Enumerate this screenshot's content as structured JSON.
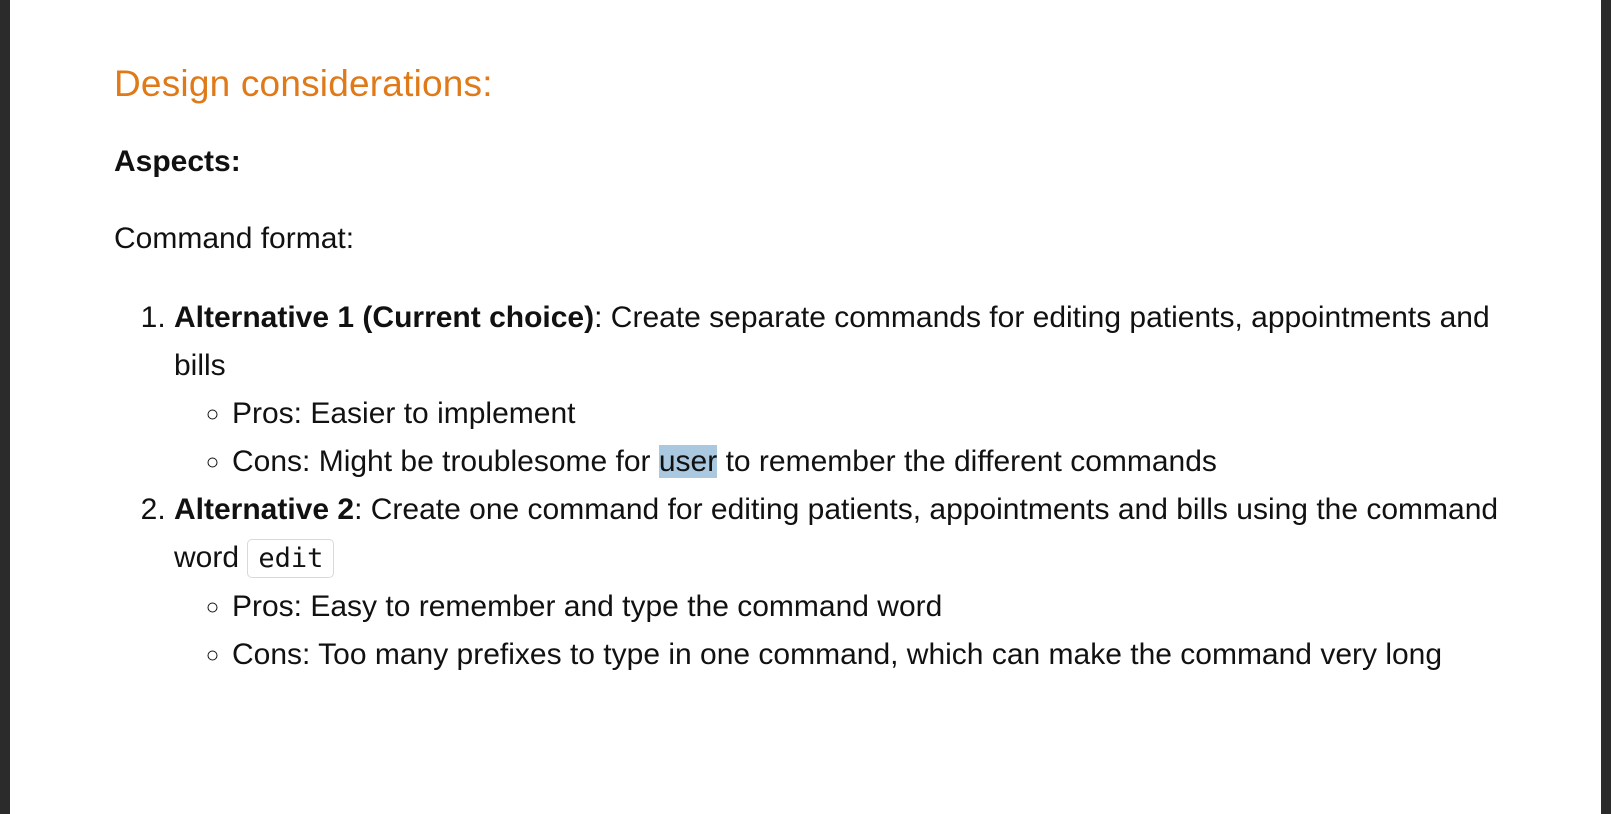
{
  "colors": {
    "heading": "#e07a19",
    "text": "#111111",
    "highlight": "#aac8e0",
    "page_background": "#ffffff",
    "frame_background": "#2b2b2b"
  },
  "heading": "Design considerations:",
  "aspects_label": "Aspects:",
  "command_format_label": "Command format:",
  "alternatives": [
    {
      "title": "Alternative 1 (Current choice)",
      "sep": ":",
      "description": " Create separate commands for editing patients, appointments and bills",
      "pros": "Pros: Easier to implement",
      "cons_before": "Cons: Might be troublesome for ",
      "cons_highlight": "user",
      "cons_after": " to remember the different commands"
    },
    {
      "title": "Alternative 2",
      "sep": ":",
      "description": " Create one command for editing patients, appointments and bills using the command word ",
      "code": "edit",
      "pros": "Pros: Easy to remember and type the command word",
      "cons": "Cons: Too many prefixes to type in one command, which can make the command very long"
    }
  ]
}
